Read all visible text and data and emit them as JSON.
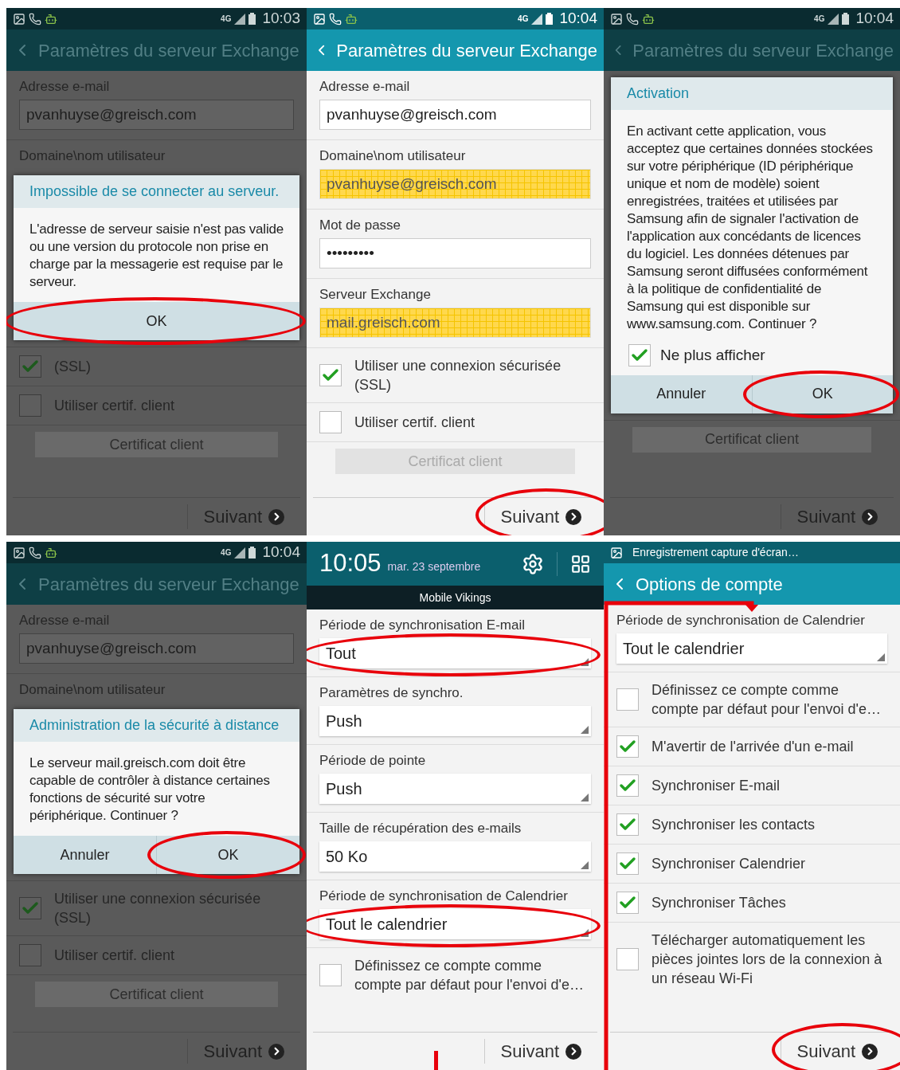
{
  "panels": [
    {
      "kind": "settings",
      "dimmed": true,
      "status": {
        "network": "4G",
        "time": "10:03"
      },
      "title": "Paramètres du serveur Exchange",
      "before": [
        {
          "kind": "label",
          "text": "Adresse e-mail"
        },
        {
          "kind": "field",
          "value": "pvanhuyse@greisch.com"
        },
        {
          "kind": "label",
          "text": "Domaine\\nom utilisateur"
        }
      ],
      "dialog": {
        "title": "Impossible de se connecter au serveur.",
        "message": "L'adresse de serveur saisie n'est pas valide ou une version du protocole non prise en charge par la messagerie est requise par le serveur.",
        "buttons": [
          {
            "label": "OK",
            "circled": true
          }
        ]
      },
      "after": [
        {
          "kind": "checkbox",
          "label": "(SSL)",
          "checked": true
        },
        {
          "kind": "checkbox",
          "label": "Utiliser certif. client",
          "checked": false
        },
        {
          "kind": "button",
          "label": "Certificat client",
          "disabled": true
        }
      ],
      "footer": {
        "label": "Suivant"
      }
    },
    {
      "kind": "settings",
      "dimmed": false,
      "status": {
        "network": "4G",
        "time": "10:04"
      },
      "title": "Paramètres du serveur Exchange",
      "before": [
        {
          "kind": "label",
          "text": "Adresse e-mail"
        },
        {
          "kind": "field",
          "value": "pvanhuyse@greisch.com"
        },
        {
          "kind": "label",
          "text": "Domaine\\nom utilisateur"
        },
        {
          "kind": "field",
          "value": "pvanhuyse@greisch.com",
          "highlighted": true
        },
        {
          "kind": "label",
          "text": "Mot de passe"
        },
        {
          "kind": "field",
          "value": "•••••••••"
        },
        {
          "kind": "label",
          "text": "Serveur Exchange"
        },
        {
          "kind": "field",
          "value": "mail.greisch.com",
          "highlighted": true
        },
        {
          "kind": "checkbox",
          "label": "Utiliser une connexion sécurisée (SSL)",
          "checked": true
        },
        {
          "kind": "checkbox",
          "label": "Utiliser certif. client",
          "checked": false
        },
        {
          "kind": "button",
          "label": "Certificat client",
          "disabled": true
        }
      ],
      "footer": {
        "label": "Suivant",
        "circled": true
      }
    },
    {
      "kind": "settings",
      "dimmed": true,
      "status": {
        "network": "4G",
        "time": "10:04"
      },
      "title": "Paramètres du serveur Exchange",
      "dialog": {
        "title": "Activation",
        "message": "En activant cette application, vous acceptez que certaines données stockées sur votre périphérique (ID périphérique unique et nom de modèle) soient enregistrées, traitées et utilisées par Samsung afin de signaler l'activation de l'application aux concédants de licences du logiciel. Les données détenues par Samsung seront diffusées conformément à la politique de confidentialité de Samsung qui est disponible sur www.samsung.com. Continuer ?",
        "checkbox": {
          "label": "Ne plus afficher",
          "checked": true
        },
        "buttons": [
          {
            "label": "Annuler"
          },
          {
            "label": "OK",
            "circled": true
          }
        ]
      },
      "after": [
        {
          "kind": "button",
          "label": "Certificat client",
          "disabled": true
        }
      ],
      "footer": {
        "label": "Suivant"
      }
    },
    {
      "kind": "settings",
      "dimmed": true,
      "status": {
        "network": "4G",
        "time": "10:04"
      },
      "title": "Paramètres du serveur Exchange",
      "before": [
        {
          "kind": "label",
          "text": "Adresse e-mail"
        },
        {
          "kind": "field",
          "value": "pvanhuyse@greisch.com"
        },
        {
          "kind": "label",
          "text": "Domaine\\nom utilisateur"
        }
      ],
      "dialog": {
        "title": "Administration de la sécurité à distance",
        "message": "Le serveur mail.greisch.com doit être capable de contrôler à distance certaines fonctions de sécurité sur votre périphérique. Continuer ?",
        "buttons": [
          {
            "label": "Annuler"
          },
          {
            "label": "OK",
            "circled": true
          }
        ]
      },
      "after": [
        {
          "kind": "checkbox",
          "label": "Utiliser une connexion sécurisée (SSL)",
          "checked": true
        },
        {
          "kind": "checkbox",
          "label": "Utiliser certif. client",
          "checked": false
        },
        {
          "kind": "button",
          "label": "Certificat client",
          "disabled": true
        }
      ],
      "footer": {
        "label": "Suivant"
      }
    },
    {
      "kind": "shade",
      "dimmed": false,
      "marker": true,
      "shade": {
        "time": "10:05",
        "date": "mar. 23 septembre",
        "carrier": "Mobile Vikings"
      },
      "before": [
        {
          "kind": "label",
          "text": "Période de synchronisation E-mail"
        },
        {
          "kind": "dropdown",
          "value": "Tout",
          "circled": true
        },
        {
          "kind": "label",
          "text": "Paramètres de synchro."
        },
        {
          "kind": "dropdown",
          "value": "Push"
        },
        {
          "kind": "label",
          "text": "Période de pointe"
        },
        {
          "kind": "dropdown",
          "value": "Push"
        },
        {
          "kind": "label",
          "text": "Taille de récupération des e-mails"
        },
        {
          "kind": "dropdown",
          "value": "50 Ko"
        },
        {
          "kind": "label",
          "text": "Période de synchronisation de Calendrier"
        },
        {
          "kind": "dropdown",
          "value": "Tout le calendrier",
          "circled": true
        },
        {
          "kind": "checkbox",
          "label": "Définissez ce compte comme compte par défaut pour l'envoi d'e…",
          "checked": false
        }
      ],
      "footer": {
        "label": "Suivant"
      }
    },
    {
      "kind": "settings",
      "dimmed": false,
      "frame": true,
      "status": {
        "notice": "Enregistrement capture d'écran…"
      },
      "title": "Options de compte",
      "before": [
        {
          "kind": "label",
          "text": "Période de synchronisation de Calendrier"
        },
        {
          "kind": "dropdown",
          "value": "Tout le calendrier"
        },
        {
          "kind": "checkbox",
          "label": "Définissez ce compte comme compte par défaut pour l'envoi d'e…",
          "checked": false
        },
        {
          "kind": "checkbox",
          "label": "M'avertir de l'arrivée d'un e-mail",
          "checked": true
        },
        {
          "kind": "checkbox",
          "label": "Synchroniser E-mail",
          "checked": true
        },
        {
          "kind": "checkbox",
          "label": "Synchroniser les contacts",
          "checked": true
        },
        {
          "kind": "checkbox",
          "label": "Synchroniser Calendrier",
          "checked": true
        },
        {
          "kind": "checkbox",
          "label": "Synchroniser Tâches",
          "checked": true
        },
        {
          "kind": "checkbox",
          "label": "Télécharger automatiquement les pièces jointes lors de la connexion à un réseau Wi-Fi",
          "checked": false
        }
      ],
      "footer": {
        "label": "Suivant",
        "circled": true
      }
    }
  ]
}
